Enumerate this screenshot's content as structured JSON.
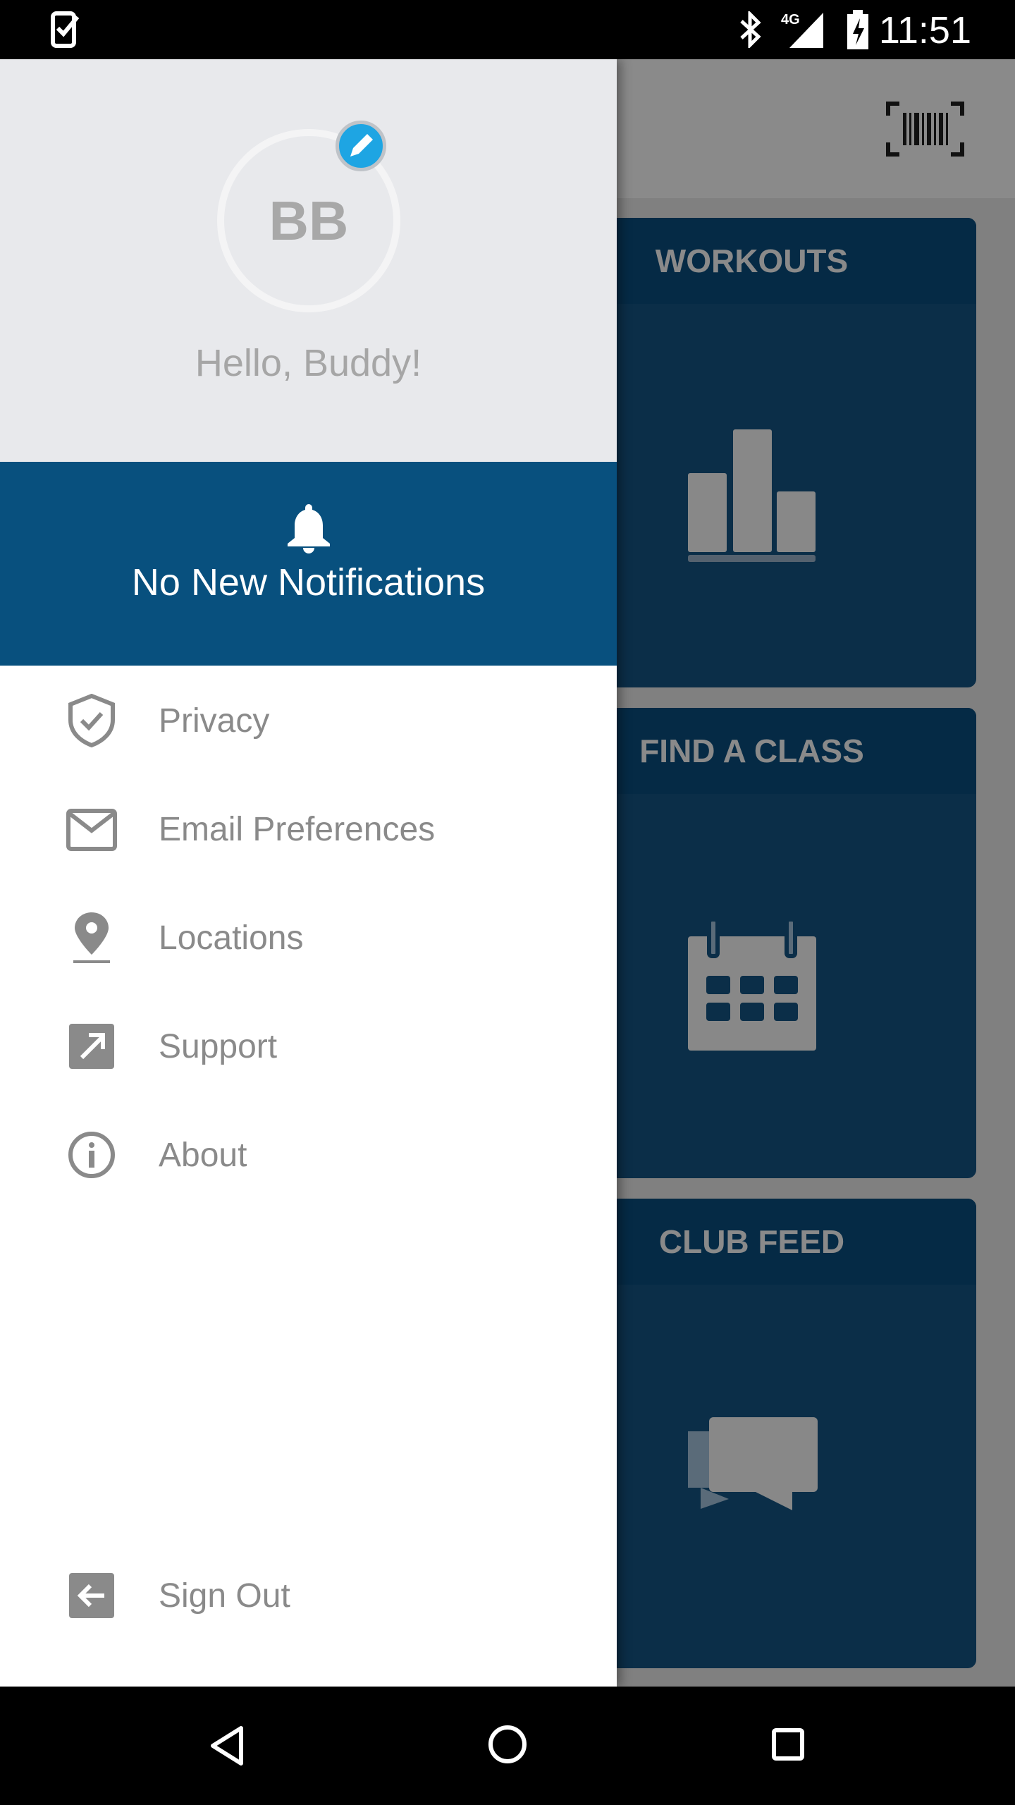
{
  "status_bar": {
    "time": "11:51",
    "icons": [
      "task-check-icon",
      "bluetooth-icon",
      "4g-signal-icon",
      "battery-charging-icon"
    ]
  },
  "app_bar": {
    "icons": [
      "barcode-scan-icon"
    ]
  },
  "cards": [
    {
      "title": "WORKOUTS",
      "icon": "bar-chart-icon"
    },
    {
      "title": "FIND A CLASS",
      "icon": "calendar-icon"
    },
    {
      "title": "CLUB FEED",
      "icon": "chat-bubbles-icon"
    }
  ],
  "drawer": {
    "avatar_initials": "BB",
    "greeting": "Hello, Buddy!",
    "notifications": "No New Notifications",
    "items": [
      {
        "label": "Privacy",
        "icon": "shield-check-icon"
      },
      {
        "label": "Email Preferences",
        "icon": "envelope-icon"
      },
      {
        "label": "Locations",
        "icon": "map-pin-icon"
      },
      {
        "label": "Support",
        "icon": "external-link-icon"
      },
      {
        "label": "About",
        "icon": "info-icon"
      }
    ],
    "sign_out": "Sign Out"
  },
  "colors": {
    "drawer_header": "#e8e9ec",
    "notification_band": "#08507e",
    "card": "#0b2e48",
    "accent": "#1ea5e3"
  }
}
